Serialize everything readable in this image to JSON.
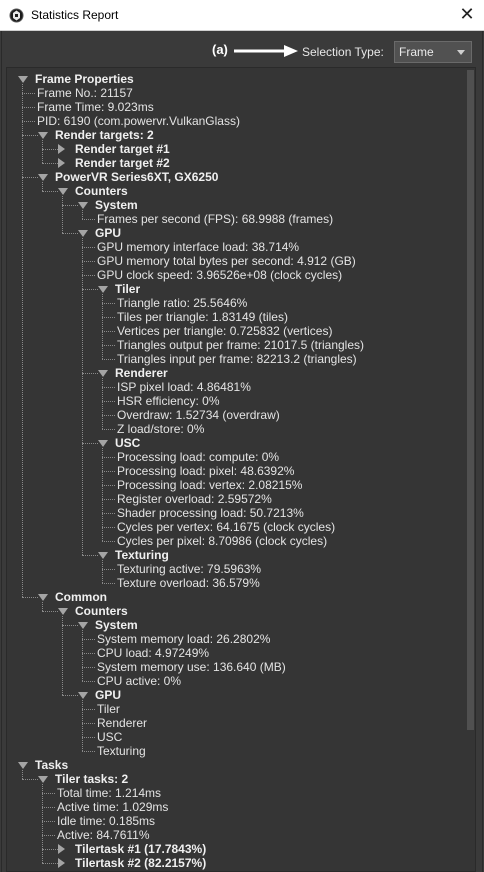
{
  "window": {
    "title": "Statistics Report",
    "close_glyph": "✕"
  },
  "annotation": {
    "label": "(a)"
  },
  "selection": {
    "label": "Selection Type:",
    "value": "Frame"
  },
  "tree": [
    {
      "depth": 0,
      "kind": "group",
      "exp": "down",
      "text": "Frame Properties"
    },
    {
      "depth": 1,
      "kind": "item",
      "text": "Frame No.: 21157"
    },
    {
      "depth": 1,
      "kind": "item",
      "text": "Frame Time: 9.023ms"
    },
    {
      "depth": 1,
      "kind": "item",
      "text": "PID: 6190 (com.powervr.VulkanGlass)"
    },
    {
      "depth": 1,
      "kind": "group",
      "exp": "down",
      "text": "Render targets: 2"
    },
    {
      "depth": 2,
      "kind": "group",
      "exp": "right",
      "text": "Render target #1"
    },
    {
      "depth": 2,
      "kind": "group",
      "exp": "right",
      "text": "Render target #2"
    },
    {
      "depth": 1,
      "kind": "group",
      "exp": "down",
      "text": "PowerVR Series6XT, GX6250"
    },
    {
      "depth": 2,
      "kind": "group",
      "exp": "down",
      "text": "Counters"
    },
    {
      "depth": 3,
      "kind": "group",
      "exp": "down",
      "text": "System"
    },
    {
      "depth": 4,
      "kind": "item",
      "text": "Frames per second (FPS): 68.9988 (frames)"
    },
    {
      "depth": 3,
      "kind": "group",
      "exp": "down",
      "text": "GPU"
    },
    {
      "depth": 4,
      "kind": "item",
      "text": "GPU memory interface load: 38.714%"
    },
    {
      "depth": 4,
      "kind": "item",
      "text": "GPU memory total bytes per second: 4.912 (GB)"
    },
    {
      "depth": 4,
      "kind": "item",
      "text": "GPU clock speed: 3.96526e+08 (clock cycles)"
    },
    {
      "depth": 4,
      "kind": "group",
      "exp": "down",
      "text": "Tiler"
    },
    {
      "depth": 5,
      "kind": "item",
      "text": "Triangle ratio: 25.5646%"
    },
    {
      "depth": 5,
      "kind": "item",
      "text": "Tiles per triangle: 1.83149 (tiles)"
    },
    {
      "depth": 5,
      "kind": "item",
      "text": "Vertices per triangle: 0.725832 (vertices)"
    },
    {
      "depth": 5,
      "kind": "item",
      "text": "Triangles output per frame: 21017.5 (triangles)"
    },
    {
      "depth": 5,
      "kind": "item",
      "text": "Triangles input per frame: 82213.2 (triangles)"
    },
    {
      "depth": 4,
      "kind": "group",
      "exp": "down",
      "text": "Renderer"
    },
    {
      "depth": 5,
      "kind": "item",
      "text": "ISP pixel load: 4.86481%"
    },
    {
      "depth": 5,
      "kind": "item",
      "text": "HSR efficiency: 0%"
    },
    {
      "depth": 5,
      "kind": "item",
      "text": "Overdraw: 1.52734 (overdraw)"
    },
    {
      "depth": 5,
      "kind": "item",
      "text": "Z load/store: 0%"
    },
    {
      "depth": 4,
      "kind": "group",
      "exp": "down",
      "text": "USC"
    },
    {
      "depth": 5,
      "kind": "item",
      "text": "Processing load: compute: 0%"
    },
    {
      "depth": 5,
      "kind": "item",
      "text": "Processing load: pixel: 48.6392%"
    },
    {
      "depth": 5,
      "kind": "item",
      "text": "Processing load: vertex: 2.08215%"
    },
    {
      "depth": 5,
      "kind": "item",
      "text": "Register overload: 2.59572%"
    },
    {
      "depth": 5,
      "kind": "item",
      "text": "Shader processing load: 50.7213%"
    },
    {
      "depth": 5,
      "kind": "item",
      "text": "Cycles per vertex: 64.1675 (clock cycles)"
    },
    {
      "depth": 5,
      "kind": "item",
      "text": "Cycles per pixel: 8.70986 (clock cycles)"
    },
    {
      "depth": 4,
      "kind": "group",
      "exp": "down",
      "text": "Texturing"
    },
    {
      "depth": 5,
      "kind": "item",
      "text": "Texturing active: 79.5963%"
    },
    {
      "depth": 5,
      "kind": "item",
      "text": "Texture overload: 36.579%"
    },
    {
      "depth": 1,
      "kind": "group",
      "exp": "down",
      "text": "Common"
    },
    {
      "depth": 2,
      "kind": "group",
      "exp": "down",
      "text": "Counters"
    },
    {
      "depth": 3,
      "kind": "group",
      "exp": "down",
      "text": "System"
    },
    {
      "depth": 4,
      "kind": "item",
      "text": "System memory load: 26.2802%"
    },
    {
      "depth": 4,
      "kind": "item",
      "text": "CPU load: 4.97249%"
    },
    {
      "depth": 4,
      "kind": "item",
      "text": "System memory use: 136.640 (MB)"
    },
    {
      "depth": 4,
      "kind": "item",
      "text": "CPU active: 0%"
    },
    {
      "depth": 3,
      "kind": "group",
      "exp": "down",
      "text": "GPU"
    },
    {
      "depth": 4,
      "kind": "item",
      "text": "Tiler"
    },
    {
      "depth": 4,
      "kind": "item",
      "text": "Renderer"
    },
    {
      "depth": 4,
      "kind": "item",
      "text": "USC"
    },
    {
      "depth": 4,
      "kind": "item",
      "text": "Texturing"
    },
    {
      "depth": 0,
      "kind": "group",
      "exp": "down",
      "text": "Tasks"
    },
    {
      "depth": 1,
      "kind": "group",
      "exp": "down",
      "text": "Tiler tasks: 2"
    },
    {
      "depth": 2,
      "kind": "item",
      "text": "Total time: 1.214ms"
    },
    {
      "depth": 2,
      "kind": "item",
      "text": "Active time: 1.029ms"
    },
    {
      "depth": 2,
      "kind": "item",
      "text": "Idle time: 0.185ms"
    },
    {
      "depth": 2,
      "kind": "item",
      "text": "Active: 84.7611%"
    },
    {
      "depth": 2,
      "kind": "group",
      "exp": "right",
      "text": "Tilertask #1 (17.7843%)"
    },
    {
      "depth": 2,
      "kind": "group",
      "exp": "right",
      "text": "Tilertask #2 (82.2157%)"
    }
  ]
}
